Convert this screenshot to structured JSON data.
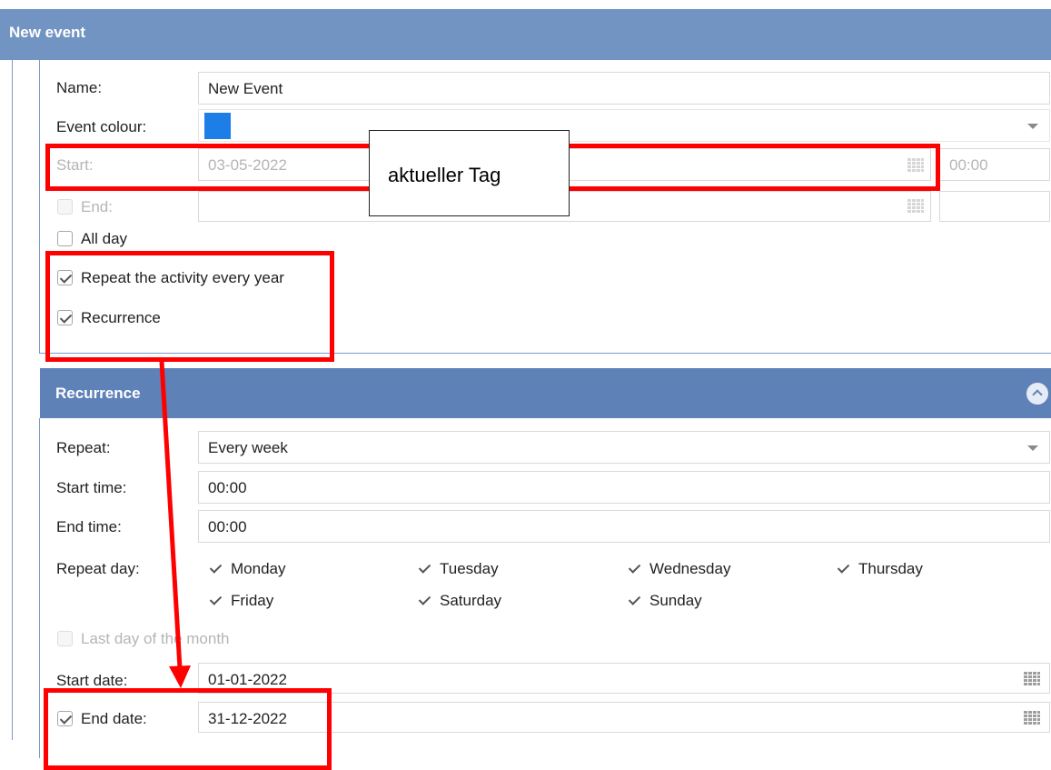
{
  "header": {
    "title": "New event"
  },
  "event": {
    "name_label": "Name:",
    "name_value": "New Event",
    "colour_label": "Event colour:",
    "colour_value": "#1e7ee8",
    "start_label": "Start:",
    "start_date": "03-05-2022",
    "start_time": "00:00",
    "end_label": "End:",
    "end_date": "",
    "end_time": "",
    "all_day_label": "All day",
    "repeat_yearly_label": "Repeat the activity every year",
    "recurrence_label": "Recurrence"
  },
  "recurrence": {
    "title": "Recurrence",
    "repeat_label": "Repeat:",
    "repeat_value": "Every week",
    "start_time_label": "Start time:",
    "start_time_value": "00:00",
    "end_time_label": "End time:",
    "end_time_value": "00:00",
    "repeat_day_label": "Repeat day:",
    "days": [
      "Monday",
      "Tuesday",
      "Wednesday",
      "Thursday",
      "Friday",
      "Saturday",
      "Sunday"
    ],
    "last_day_label": "Last day of the month",
    "start_date_label": "Start date:",
    "start_date_value": "01-01-2022",
    "end_date_label": "End date:",
    "end_date_value": "31-12-2022"
  },
  "annotation": {
    "callout_text": "aktueller Tag",
    "highlight_color": "#ff0000"
  },
  "colors": {
    "header": "#7294c2",
    "section_header": "#5e81b8"
  }
}
